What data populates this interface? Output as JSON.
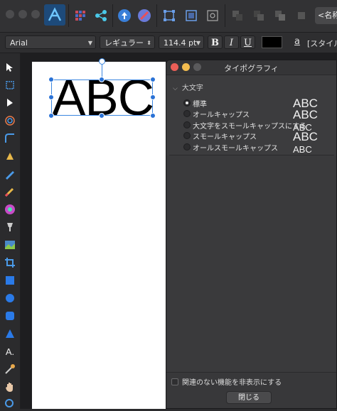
{
  "toolbar": {
    "style_button_label": "<名称未",
    "icons": [
      "app-icon",
      "grid-icon",
      "share-icon",
      "upload-icon",
      "pen-nib-icon",
      "snap-icon",
      "transform-icon",
      "align-icon"
    ]
  },
  "context_toolbar": {
    "font_family": "Arial",
    "font_style": "レギュラー",
    "font_size": "114.4 pt",
    "bold_label": "B",
    "italic_label": "I",
    "underline_label": "U",
    "text_color": "#000000",
    "link_label": "a",
    "style_label": "[スタイル"
  },
  "canvas": {
    "text": "ABC"
  },
  "panel": {
    "title": "タイポグラフィ",
    "section": "大文字",
    "options": [
      {
        "label": "標準",
        "selected": true,
        "preview": "ABC"
      },
      {
        "label": "オールキャップス",
        "selected": false,
        "preview": "ABC"
      },
      {
        "label": "大文字をスモールキャップスにする",
        "selected": false,
        "preview": "ABC"
      },
      {
        "label": "スモールキャップス",
        "selected": false,
        "preview": "ABC"
      },
      {
        "label": "オールスモールキャップス",
        "selected": false,
        "preview": "ABC"
      }
    ],
    "hide_unrelated_label": "関連のない機能を非表示にする",
    "close_label": "閉じる"
  },
  "colors": {
    "accent": "#2a72d6",
    "close_dot": "#ec5f57",
    "minimize_dot": "#f4bd4f",
    "panel_bg": "#3c3c3e"
  }
}
